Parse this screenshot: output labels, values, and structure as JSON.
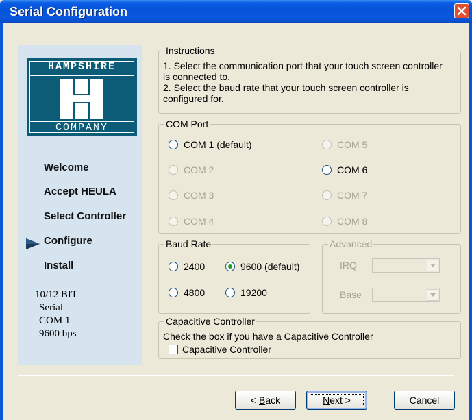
{
  "window": {
    "title": "Serial Configuration"
  },
  "logo": {
    "top_text": "HAMPSHIRE",
    "bottom_text": "COMPANY"
  },
  "steps": [
    {
      "label": "Welcome",
      "current": false
    },
    {
      "label": "Accept HEULA",
      "current": false
    },
    {
      "label": "Select Controller",
      "current": false
    },
    {
      "label": "Configure",
      "current": true
    },
    {
      "label": "Install",
      "current": false
    }
  ],
  "summary": [
    "10/12 BIT",
    "Serial",
    "COM 1",
    "9600 bps"
  ],
  "instructions": {
    "legend": "Instructions",
    "line1": "1. Select the communication port that your touch screen controller is connected to.",
    "line2": "2. Select the baud rate that your touch screen controller is configured for."
  },
  "com_port": {
    "legend": "COM Port",
    "options": [
      {
        "label": "COM 1 (default)",
        "enabled": true,
        "selected": false
      },
      {
        "label": "COM 2",
        "enabled": false,
        "selected": false
      },
      {
        "label": "COM 3",
        "enabled": false,
        "selected": false
      },
      {
        "label": "COM 4",
        "enabled": false,
        "selected": false
      },
      {
        "label": "COM 5",
        "enabled": false,
        "selected": false
      },
      {
        "label": "COM 6",
        "enabled": true,
        "selected": false
      },
      {
        "label": "COM 7",
        "enabled": false,
        "selected": false
      },
      {
        "label": "COM 8",
        "enabled": false,
        "selected": false
      }
    ]
  },
  "baud_rate": {
    "legend": "Baud Rate",
    "options": [
      {
        "label": "2400",
        "selected": false
      },
      {
        "label": "9600 (default)",
        "selected": true
      },
      {
        "label": "4800",
        "selected": false
      },
      {
        "label": "19200",
        "selected": false
      }
    ]
  },
  "advanced": {
    "legend": "Advanced",
    "irq_label": "IRQ",
    "base_label": "Base",
    "irq_value": "",
    "base_value": ""
  },
  "capacitive": {
    "legend": "Capacitive Controller",
    "description": "Check the box if you have a Capacitive Controller",
    "checkbox_label": "Capacitive Controller",
    "checked": false
  },
  "buttons": {
    "back_mnemonic": "B",
    "back_rest": "ack",
    "back_prefix": "< ",
    "next_mnemonic": "N",
    "next_rest": "ext >",
    "cancel": "Cancel"
  },
  "colors": {
    "title_bar": "#0554d8",
    "side_panel": "#d6e4f0",
    "logo_bg": "#0c5c78",
    "dialog_bg": "#ece9d8"
  },
  "icons": {
    "close": "close-icon",
    "current_step": "arrow-right-icon",
    "radio": "radio-icon",
    "dropdown": "chevron-down-icon"
  }
}
